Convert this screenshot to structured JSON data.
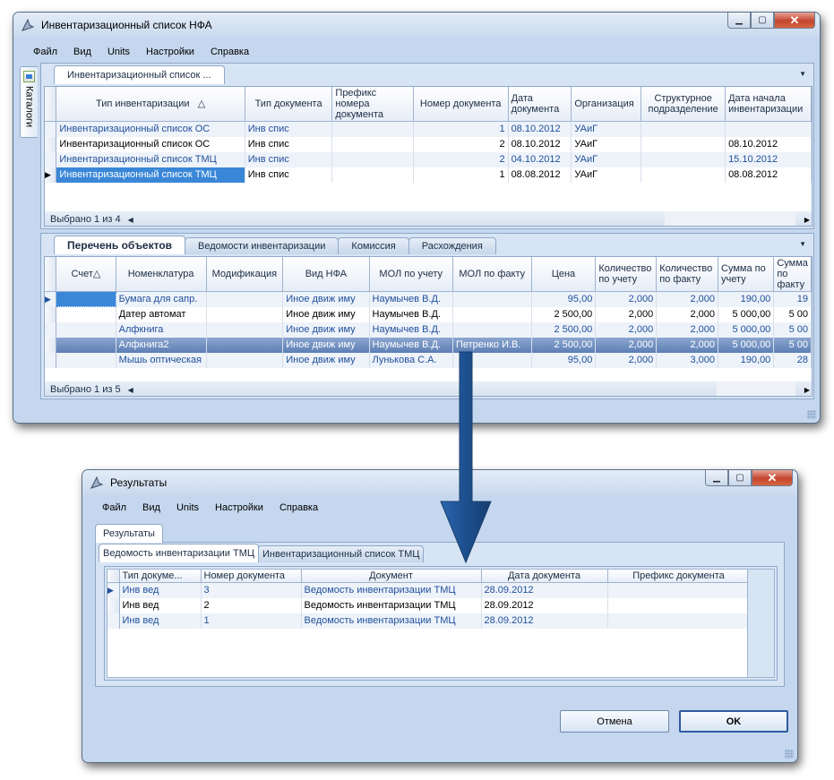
{
  "main_window": {
    "title": "Инвентаризационный список НФА",
    "menu": [
      "Файл",
      "Вид",
      "Units",
      "Настройки",
      "Справка"
    ],
    "side_tab": "Каталоги",
    "doc_tab": "Инвентаризационный список ...",
    "top_grid": {
      "columns": [
        "Тип инвентаризации",
        "Тип документа",
        "Префикс номера документа",
        "Номер документа",
        "Дата документа",
        "Организация",
        "Структурное подразделение",
        "Дата начала инвентаризации"
      ],
      "rows": [
        [
          "Инвентаризационный список ОС",
          "Инв спис",
          "",
          "1",
          "08.10.2012",
          "УАиГ",
          "",
          ""
        ],
        [
          "Инвентаризационный список ОС",
          "Инв спис",
          "",
          "2",
          "08.10.2012",
          "УАиГ",
          "",
          "08.10.2012"
        ],
        [
          "Инвентаризационный список ТМЦ",
          "Инв спис",
          "",
          "2",
          "04.10.2012",
          "УАиГ",
          "",
          "15.10.2012"
        ],
        [
          "Инвентаризационный список ТМЦ",
          "Инв спис",
          "",
          "1",
          "08.08.2012",
          "УАиГ",
          "",
          "08.08.2012"
        ]
      ],
      "status": "Выбрано 1 из 4"
    },
    "bottom_tabs": [
      "Перечень объектов",
      "Ведомости инвентаризации",
      "Комиссия",
      "Расхождения"
    ],
    "bottom_grid": {
      "columns": [
        "Счет",
        "Номенклатура",
        "Модификация",
        "Вид НФА",
        "МОЛ по учету",
        "МОЛ по факту",
        "Цена",
        "Количество по учету",
        "Количество по факту",
        "Сумма по учету",
        "Сумма по факту"
      ],
      "rows": [
        [
          "",
          "Бумага  для сапр.",
          "",
          "Иное движ иму",
          "Наумычев В.Д.",
          "",
          "95,00",
          "2,000",
          "2,000",
          "190,00",
          "19"
        ],
        [
          "",
          "Датер автомат",
          "",
          "Иное движ иму",
          "Наумычев В.Д.",
          "",
          "2 500,00",
          "2,000",
          "2,000",
          "5 000,00",
          "5 00"
        ],
        [
          "",
          "Алфкнига",
          "",
          "Иное движ иму",
          "Наумычев В.Д.",
          "",
          "2 500,00",
          "2,000",
          "2,000",
          "5 000,00",
          "5 00"
        ],
        [
          "",
          "Алфкнига2",
          "",
          "Иное движ иму",
          "Наумычев В.Д.",
          "Петренко И.В.",
          "2 500,00",
          "2,000",
          "2,000",
          "5 000,00",
          "5 00"
        ],
        [
          "",
          "Мышь оптическая",
          "",
          "Иное движ иму",
          "Лунькова С.А.",
          "",
          "95,00",
          "2,000",
          "3,000",
          "190,00",
          "28"
        ]
      ],
      "status": "Выбрано 1 из 5"
    }
  },
  "results_window": {
    "title": "Результаты",
    "menu": [
      "Файл",
      "Вид",
      "Units",
      "Настройки",
      "Справка"
    ],
    "outer_tab": "Результаты",
    "inner_tabs": [
      "Ведомость инвентаризации ТМЦ",
      "Инвентаризационный список ТМЦ"
    ],
    "grid": {
      "columns": [
        "Тип докуме...",
        "Номер документа",
        "Документ",
        "Дата документа",
        "Префикс документа"
      ],
      "rows": [
        [
          "Инв вед",
          "3",
          "Ведомость инвентаризации ТМЦ",
          "28.09.2012",
          ""
        ],
        [
          "Инв вед",
          "2",
          "Ведомость инвентаризации ТМЦ",
          "28.09.2012",
          ""
        ],
        [
          "Инв вед",
          "1",
          "Ведомость инвентаризации ТМЦ",
          "28.09.2012",
          ""
        ]
      ]
    },
    "cancel_label": "Отмена",
    "ok_label": "OK"
  },
  "colors": {
    "accent": "#3a87d8",
    "arrow": "#1d4f8e",
    "close": "#c24630"
  }
}
